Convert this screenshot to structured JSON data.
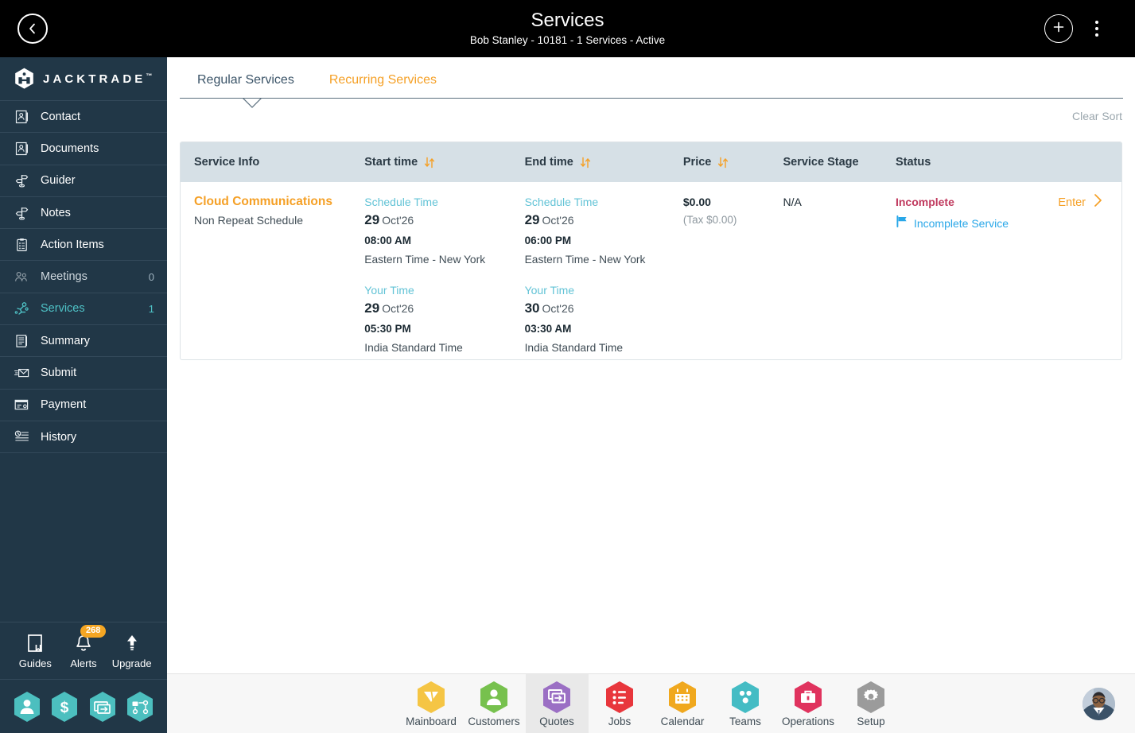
{
  "topbar": {
    "back_icon": "chevron-left-icon",
    "title": "Services",
    "subtitle": "Bob Stanley - 10181 - 1 Services - Active",
    "add_icon": "plus-circle-icon",
    "menu_icon": "kebab-menu-icon"
  },
  "sidebar": {
    "logo_text": "JACKTRADE",
    "logo_tm": "™",
    "items": [
      {
        "label": "Contact",
        "icon": "contact-card-icon",
        "count": ""
      },
      {
        "label": "Documents",
        "icon": "document-icon",
        "count": ""
      },
      {
        "label": "Guider",
        "icon": "signpost-icon",
        "count": ""
      },
      {
        "label": "Notes",
        "icon": "signpost-icon",
        "count": ""
      },
      {
        "label": "Action Items",
        "icon": "clipboard-icon",
        "count": ""
      },
      {
        "label": "Meetings",
        "icon": "meetings-icon",
        "count": "0"
      },
      {
        "label": "Services",
        "icon": "services-icon",
        "count": "1"
      },
      {
        "label": "Summary",
        "icon": "book-icon",
        "count": ""
      },
      {
        "label": "Submit",
        "icon": "send-mail-icon",
        "count": ""
      },
      {
        "label": "Payment",
        "icon": "payment-card-icon",
        "count": ""
      },
      {
        "label": "History",
        "icon": "history-icon",
        "count": ""
      }
    ],
    "active_index": 6,
    "tools": [
      {
        "label": "Guides",
        "icon": "book-bookmark-icon",
        "badge": ""
      },
      {
        "label": "Alerts",
        "icon": "bell-icon",
        "badge": "268"
      },
      {
        "label": "Upgrade",
        "icon": "arrow-up-icon",
        "badge": ""
      }
    ],
    "quick_hexes": [
      {
        "icon": "person-icon"
      },
      {
        "icon": "dollar-icon"
      },
      {
        "icon": "quote-icon"
      },
      {
        "icon": "workflow-icon"
      }
    ]
  },
  "main": {
    "tabs": [
      {
        "label": "Regular Services",
        "active": true
      },
      {
        "label": "Recurring Services",
        "active": false
      }
    ],
    "clear_sort": "Clear Sort",
    "table": {
      "columns": [
        {
          "label": "Service Info",
          "sortable": false
        },
        {
          "label": "Start time",
          "sortable": true
        },
        {
          "label": "End time",
          "sortable": true
        },
        {
          "label": "Price",
          "sortable": true
        },
        {
          "label": "Service Stage",
          "sortable": false
        },
        {
          "label": "Status",
          "sortable": false
        }
      ],
      "rows": [
        {
          "service_name": "Cloud Communications",
          "service_sub": "Non Repeat Schedule",
          "start": {
            "schedule_label": "Schedule Time",
            "schedule_day": "29",
            "schedule_month": "Oct'26",
            "schedule_time": "08:00 AM",
            "schedule_zone": "Eastern Time - New York",
            "your_label": "Your Time",
            "your_day": "29",
            "your_month": "Oct'26",
            "your_time": "05:30 PM",
            "your_zone": "India Standard Time"
          },
          "end": {
            "schedule_label": "Schedule Time",
            "schedule_day": "29",
            "schedule_month": "Oct'26",
            "schedule_time": "06:00 PM",
            "schedule_zone": "Eastern Time - New York",
            "your_label": "Your Time",
            "your_day": "30",
            "your_month": "Oct'26",
            "your_time": "03:30 AM",
            "your_zone": "India Standard Time"
          },
          "price": "$0.00",
          "price_tax": "(Tax $0.00)",
          "stage": "N/A",
          "status": "Incomplete",
          "status_flag_label": "Incomplete Service",
          "enter_label": "Enter"
        }
      ]
    }
  },
  "bottombar": {
    "items": [
      {
        "label": "Mainboard",
        "icon": "mainboard-icon",
        "color": "#f5c544",
        "selected": false
      },
      {
        "label": "Customers",
        "icon": "customers-icon",
        "color": "#77c14e",
        "selected": false
      },
      {
        "label": "Quotes",
        "icon": "quotes-icon",
        "color": "#9b6fc4",
        "selected": true
      },
      {
        "label": "Jobs",
        "icon": "jobs-icon",
        "color": "#e8363c",
        "selected": false
      },
      {
        "label": "Calendar",
        "icon": "calendar-icon",
        "color": "#f0a81e",
        "selected": false
      },
      {
        "label": "Teams",
        "icon": "teams-icon",
        "color": "#44bcc4",
        "selected": false
      },
      {
        "label": "Operations",
        "icon": "operations-icon",
        "color": "#e0335e",
        "selected": false
      },
      {
        "label": "Setup",
        "icon": "setup-icon",
        "color": "#9b9b9b",
        "selected": false
      }
    ],
    "avatar": "user-avatar"
  },
  "colors": {
    "topbar_bg": "#000000",
    "sidebar_bg": "#213747",
    "accent_orange": "#f5a026",
    "accent_teal": "#4fc3c7",
    "status_red": "#c0395e",
    "link_blue": "#29a7e8",
    "table_header_bg": "#d6e0e6"
  }
}
